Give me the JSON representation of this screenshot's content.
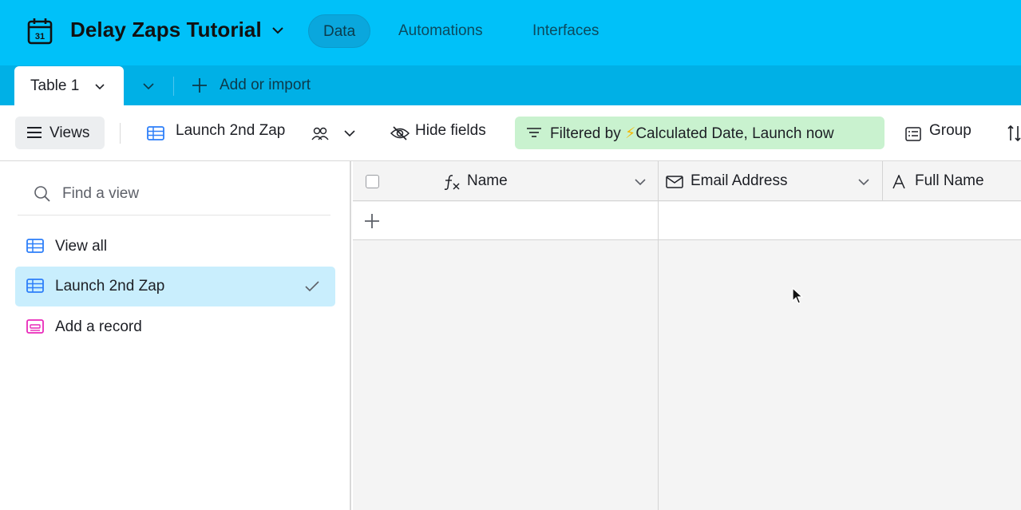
{
  "app": {
    "base_title": "Delay Zaps Tutorial",
    "calendar_day": "31",
    "nav": [
      {
        "label": "Data",
        "active": true
      },
      {
        "label": "Automations",
        "active": false
      },
      {
        "label": "Interfaces",
        "active": false
      }
    ]
  },
  "tables": {
    "active_tab": "Table 1",
    "add_label": "Add or import"
  },
  "toolbar": {
    "views_label": "Views",
    "current_view": "Launch 2nd Zap",
    "hide_fields": "Hide fields",
    "filter_prefix": "Filtered by ",
    "filter_bolt": "⚡",
    "filter_fields": "Calculated Date, Launch now",
    "group": "Group"
  },
  "sidebar": {
    "search_placeholder": "Find a view",
    "items": [
      {
        "label": "View all",
        "icon": "grid-view-icon",
        "selected": false
      },
      {
        "label": "Launch 2nd Zap",
        "icon": "grid-view-icon",
        "selected": true
      },
      {
        "label": "Add a record",
        "icon": "form-view-icon",
        "selected": false
      }
    ]
  },
  "grid": {
    "columns": [
      {
        "label": "Name",
        "icon": "formula-icon"
      },
      {
        "label": "Email Address",
        "icon": "email-icon"
      },
      {
        "label": "Full Name",
        "icon": "text-icon"
      }
    ]
  },
  "colors": {
    "topbar": "#00c1f9",
    "tabbar": "#00b0e6",
    "filter_chip": "#c9f2cf",
    "selected_view": "#c9eefd"
  }
}
